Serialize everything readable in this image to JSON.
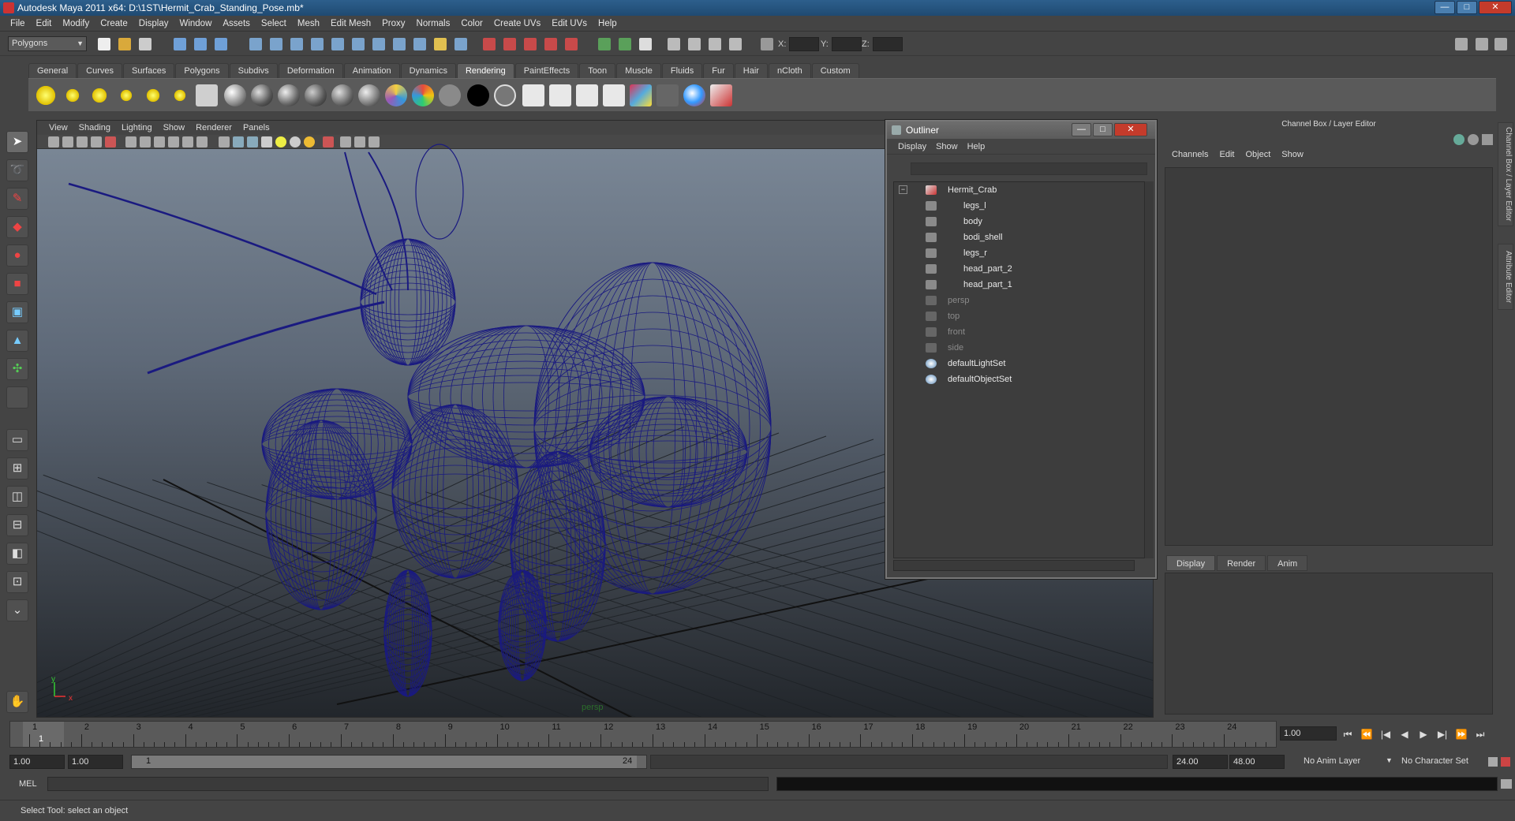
{
  "window": {
    "title": "Autodesk Maya 2011 x64: D:\\1ST\\Hermit_Crab_Standing_Pose.mb*",
    "minimize": "—",
    "maximize": "□",
    "close": "✕"
  },
  "menubar": [
    "File",
    "Edit",
    "Modify",
    "Create",
    "Display",
    "Window",
    "Assets",
    "Select",
    "Mesh",
    "Edit Mesh",
    "Proxy",
    "Normals",
    "Color",
    "Create UVs",
    "Edit UVs",
    "Help"
  ],
  "statusline": {
    "mode": "Polygons",
    "coord_x": "X:",
    "coord_y": "Y:",
    "coord_z": "Z:"
  },
  "shelf": {
    "tabs": [
      "General",
      "Curves",
      "Surfaces",
      "Polygons",
      "Subdivs",
      "Deformation",
      "Animation",
      "Dynamics",
      "Rendering",
      "PaintEffects",
      "Toon",
      "Muscle",
      "Fluids",
      "Fur",
      "Hair",
      "nCloth",
      "Custom"
    ],
    "active_tab": "Rendering"
  },
  "viewport": {
    "menu": [
      "View",
      "Shading",
      "Lighting",
      "Show",
      "Renderer",
      "Panels"
    ],
    "camera": "persp",
    "axis_x": "x",
    "axis_y": "y"
  },
  "outliner": {
    "title": "Outliner",
    "menu": [
      "Display",
      "Show",
      "Help"
    ],
    "expander": "−",
    "items": [
      {
        "label": "Hermit_Crab",
        "dim": false
      },
      {
        "label": "legs_l",
        "dim": false
      },
      {
        "label": "body",
        "dim": false
      },
      {
        "label": "bodi_shell",
        "dim": false
      },
      {
        "label": "legs_r",
        "dim": false
      },
      {
        "label": "head_part_2",
        "dim": false
      },
      {
        "label": "head_part_1",
        "dim": false
      },
      {
        "label": "persp",
        "dim": true
      },
      {
        "label": "top",
        "dim": true
      },
      {
        "label": "front",
        "dim": true
      },
      {
        "label": "side",
        "dim": true
      },
      {
        "label": "defaultLightSet",
        "dim": false
      },
      {
        "label": "defaultObjectSet",
        "dim": false
      }
    ]
  },
  "channelbox": {
    "title": "Channel Box / Layer Editor",
    "menu": [
      "Channels",
      "Edit",
      "Object",
      "Show"
    ],
    "layer_tabs": [
      "Display",
      "Render",
      "Anim"
    ],
    "side_tabs": [
      "Channel Box / Layer Editor",
      "Attribute Editor"
    ]
  },
  "timeline": {
    "ticks": [
      "1",
      "2",
      "3",
      "4",
      "5",
      "6",
      "7",
      "8",
      "9",
      "10",
      "11",
      "12",
      "13",
      "14",
      "15",
      "16",
      "17",
      "18",
      "19",
      "20",
      "21",
      "22",
      "23",
      "24"
    ],
    "current_frame_marker": "1",
    "current_time": "1.00",
    "playback": [
      "⏮",
      "⏪",
      "|◀",
      "◀",
      "▶",
      "▶|",
      "⏩",
      "⏭"
    ]
  },
  "range": {
    "start_time": "1.00",
    "playback_start": "1.00",
    "range_start_label": "1",
    "range_end_label": "24",
    "playback_end": "24.00",
    "end_time": "48.00",
    "anim_layer": "No Anim Layer",
    "character_set": "No Character Set"
  },
  "cmdline": {
    "label": "MEL"
  },
  "helpline": "Select Tool: select an object",
  "colors": {
    "wireframe": "#1a1a80",
    "accent": "#5e5e5e"
  }
}
